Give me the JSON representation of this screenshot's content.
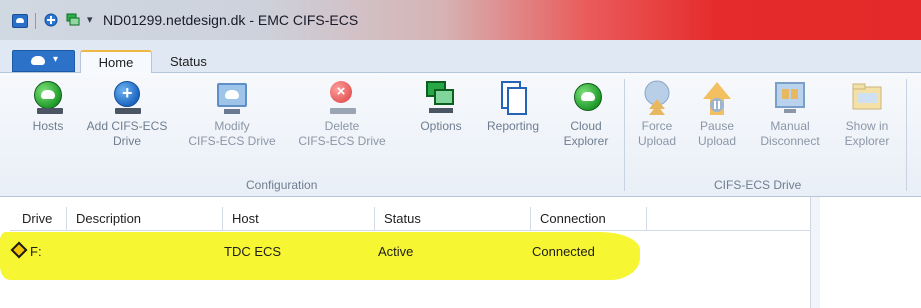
{
  "window": {
    "title": "ND01299.netdesign.dk - EMC CIFS-ECS",
    "quick_access_drop": "▾"
  },
  "tabs": [
    {
      "label": "Home"
    },
    {
      "label": "Status"
    }
  ],
  "file_menu_caret": "▾",
  "ribbon": {
    "groups": [
      {
        "label": "Configuration"
      },
      {
        "label": "CIFS-ECS Drive"
      }
    ],
    "buttons": [
      {
        "label_line1": "Hosts",
        "label_line2": ""
      },
      {
        "label_line1": "Add CIFS-ECS",
        "label_line2": "Drive"
      },
      {
        "label_line1": "Modify",
        "label_line2": "CIFS-ECS Drive"
      },
      {
        "label_line1": "Delete",
        "label_line2": "CIFS-ECS Drive"
      },
      {
        "label_line1": "Options",
        "label_line2": ""
      },
      {
        "label_line1": "Reporting",
        "label_line2": ""
      },
      {
        "label_line1": "Cloud",
        "label_line2": "Explorer"
      },
      {
        "label_line1": "Force",
        "label_line2": "Upload"
      },
      {
        "label_line1": "Pause",
        "label_line2": "Upload"
      },
      {
        "label_line1": "Manual",
        "label_line2": "Disconnect"
      },
      {
        "label_line1": "Show in",
        "label_line2": "Explorer"
      }
    ]
  },
  "table": {
    "columns": [
      "Drive",
      "Description",
      "Host",
      "Status",
      "Connection"
    ],
    "rows": [
      {
        "drive": "F:",
        "description": "",
        "host": "TDC ECS",
        "status": "Active",
        "connection": "Connected"
      }
    ]
  },
  "colors": {
    "highlight": "#f6f628",
    "accent": "#2d72c9",
    "title_gradient_end": "#e52b2b"
  }
}
